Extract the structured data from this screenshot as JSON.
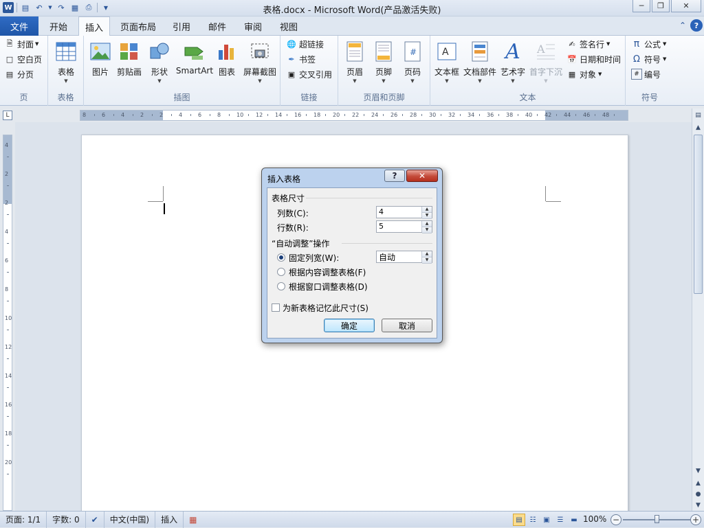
{
  "window": {
    "title": "表格.docx  -  Microsoft Word(产品激活失败)"
  },
  "quick_access": {
    "icons": [
      "word-logo-icon",
      "save-icon",
      "undo-icon",
      "redo-icon",
      "print-preview-icon",
      "print-icon",
      "customize-icon"
    ],
    "word_logo": "W"
  },
  "tabs": {
    "file": "文件",
    "home": "开始",
    "insert": "插入",
    "layout": "页面布局",
    "references": "引用",
    "mailings": "邮件",
    "review": "审阅",
    "view": "视图"
  },
  "ribbon": {
    "pages": {
      "label": "页",
      "cover": "封面",
      "blank": "空白页",
      "break": "分页"
    },
    "tables": {
      "label": "表格",
      "table": "表格"
    },
    "illustrations": {
      "label": "插图",
      "picture": "图片",
      "clipart": "剪贴画",
      "shapes": "形状",
      "smartart": "SmartArt",
      "chart": "图表",
      "screenshot": "屏幕截图"
    },
    "links": {
      "label": "链接",
      "hyperlink": "超链接",
      "bookmark": "书签",
      "crossref": "交叉引用"
    },
    "header_footer": {
      "label": "页眉和页脚",
      "header": "页眉",
      "footer": "页脚",
      "page_number": "页码"
    },
    "text": {
      "label": "文本",
      "textbox": "文本框",
      "quickparts": "文档部件",
      "wordart": "艺术字",
      "dropcap": "首字下沉",
      "signature": "签名行",
      "datetime": "日期和时间",
      "object": "对象"
    },
    "symbols": {
      "label": "符号",
      "equation": "公式",
      "symbol": "符号",
      "numbering": "编号"
    }
  },
  "ruler": {
    "h_numbers": [
      "8",
      "6",
      "4",
      "2",
      "2",
      "4",
      "6",
      "8",
      "10",
      "12",
      "14",
      "16",
      "18",
      "20",
      "22",
      "24",
      "26",
      "28",
      "30",
      "32",
      "34",
      "36",
      "38",
      "40",
      "42",
      "44",
      "46",
      "48"
    ],
    "v_numbers": [
      "4",
      "2",
      "2",
      "4",
      "6",
      "8",
      "10",
      "12",
      "14",
      "16",
      "18",
      "20"
    ]
  },
  "dialog": {
    "title": "插入表格",
    "size_section": "表格尺寸",
    "columns_label": "列数(C):",
    "columns_value": "4",
    "rows_label": "行数(R):",
    "rows_value": "5",
    "autofit_section": "“自动调整”操作",
    "fixed_width_label": "固定列宽(W):",
    "fixed_width_value": "自动",
    "autofit_content_label": "根据内容调整表格(F)",
    "autofit_window_label": "根据窗口调整表格(D)",
    "remember_label": "为新表格记忆此尺寸(S)",
    "ok": "确定",
    "cancel": "取消"
  },
  "status": {
    "page": "页面: 1/1",
    "words": "字数: 0",
    "language": "中文(中国)",
    "mode": "插入",
    "zoom": "100%"
  },
  "colors": {
    "accent": "#2b579a",
    "file_tab": "#2a62b8",
    "dialog_frame": "#bcd2ee",
    "close_red": "#c44a3a"
  }
}
